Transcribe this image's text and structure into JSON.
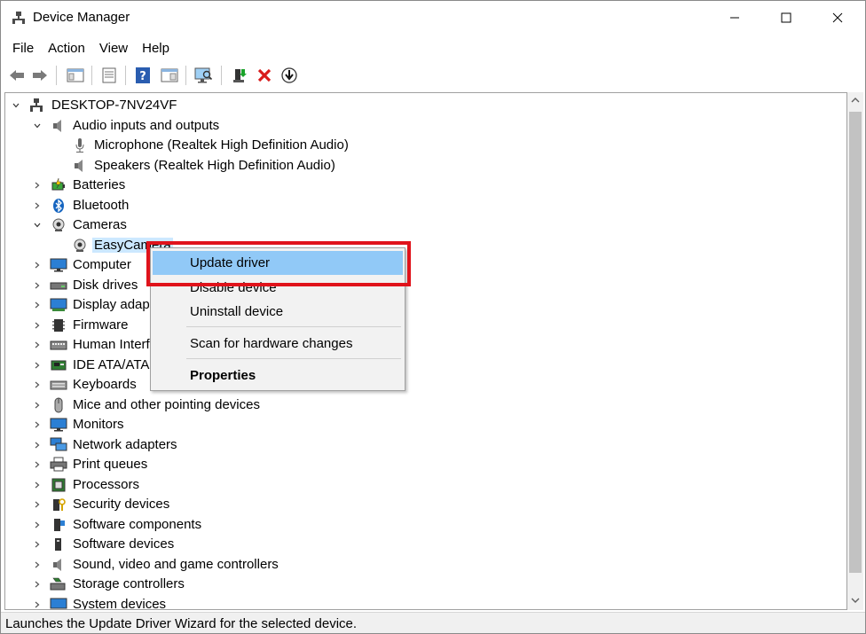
{
  "window": {
    "title": "Device Manager"
  },
  "menu": [
    "File",
    "Action",
    "View",
    "Help"
  ],
  "tree": {
    "root": "DESKTOP-7NV24VF",
    "audio": {
      "label": "Audio inputs and outputs",
      "children": [
        "Microphone (Realtek High Definition Audio)",
        "Speakers (Realtek High Definition Audio)"
      ]
    },
    "batteries": "Batteries",
    "bluetooth": "Bluetooth",
    "cameras": {
      "label": "Cameras",
      "children": [
        "EasyCamera"
      ]
    },
    "computer": "Computer",
    "disk": "Disk drives",
    "display": "Display adapters",
    "firmware": "Firmware",
    "hid": "Human Interface Devices",
    "ide": "IDE ATA/ATAPI controllers",
    "keyboards": "Keyboards",
    "mice": "Mice and other pointing devices",
    "monitors": "Monitors",
    "network": "Network adapters",
    "print": "Print queues",
    "processors": "Processors",
    "security": "Security devices",
    "software_components": "Software components",
    "software_devices": "Software devices",
    "sound": "Sound, video and game controllers",
    "storage": "Storage controllers",
    "system": "System devices"
  },
  "context_menu": {
    "update": "Update driver",
    "disable": "Disable device",
    "uninstall": "Uninstall device",
    "scan": "Scan for hardware changes",
    "properties": "Properties"
  },
  "status": "Launches the Update Driver Wizard for the selected device.",
  "colors": {
    "selection": "#cce8ff",
    "menu_hover": "#91c9f7",
    "highlight_border": "#e0131b"
  }
}
